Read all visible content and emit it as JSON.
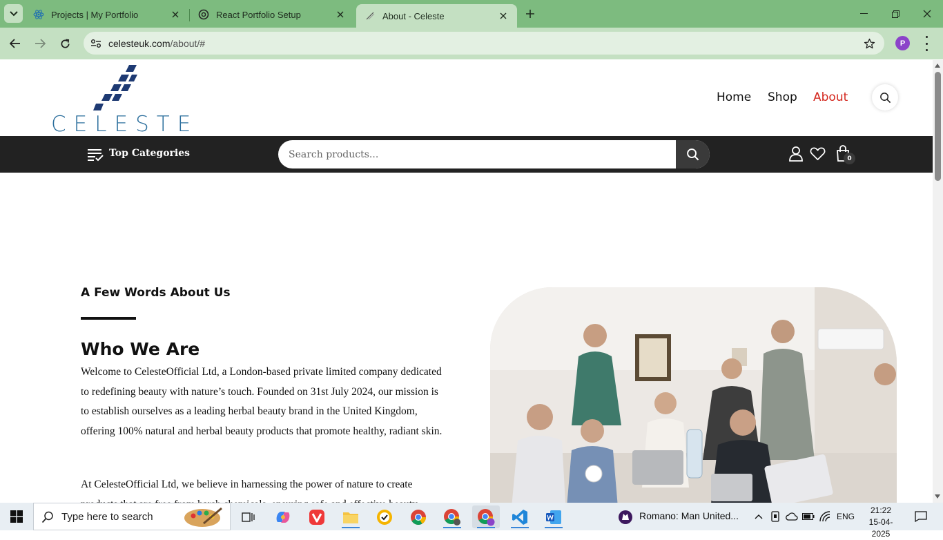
{
  "browser": {
    "tabs": [
      {
        "title": "Projects | My Portfolio",
        "icon": "react-icon"
      },
      {
        "title": "React Portfolio Setup",
        "icon": "openai-icon"
      },
      {
        "title": "About - Celeste",
        "icon": "celeste-favicon",
        "active": true
      }
    ],
    "url_host": "celesteuk.com",
    "url_path": "/about/#",
    "profile_initial": "P"
  },
  "site": {
    "logo_text": "CELESTE",
    "nav": [
      {
        "label": "Home"
      },
      {
        "label": "Shop"
      },
      {
        "label": "About",
        "active": true
      }
    ],
    "accent_color": "#d4271e",
    "categories_label": "Top Categories",
    "search_placeholder": "Search products...",
    "cart_count": "0"
  },
  "about": {
    "eyebrow": "A Few Words About Us",
    "heading": "Who We Are",
    "paragraph1": "Welcome to CelesteOfficial Ltd, a London-based private limited company dedicated to redefining beauty with nature’s touch. Founded on 31st July 2024, our mission is to establish ourselves as a leading herbal beauty brand in the United Kingdom, offering 100% natural and herbal beauty products that promote healthy, radiant skin.",
    "paragraph2": "At CelesteOfficial Ltd, we believe in harnessing the power of nature to create products that are free from harsh chemicals, ensuring safe and effective beauty"
  },
  "taskbar": {
    "search_placeholder": "Type here to search",
    "news": "Romano: Man United...",
    "lang": "ENG",
    "time": "21:22",
    "date": "15-04-2025"
  }
}
